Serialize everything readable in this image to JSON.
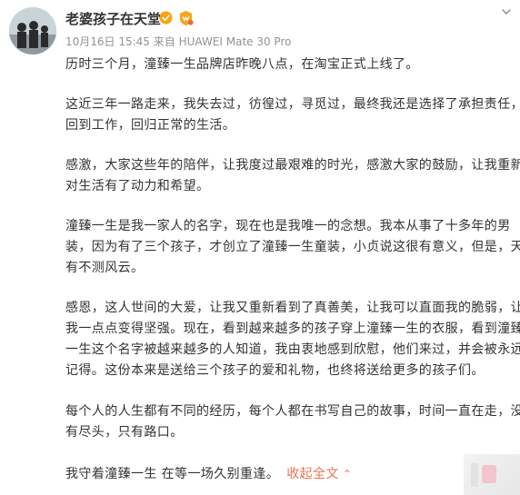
{
  "user": {
    "name": "老婆孩子在天堂"
  },
  "meta": {
    "datetime": "10月16日 15:45",
    "source": "来自 HUAWEI Mate 30 Pro"
  },
  "post": {
    "paragraphs": [
      [
        "历时三个月，潼臻一生品牌店昨晚八点，在淘宝正式上线了。"
      ],
      [
        "这近三年一路走来，我失去过，彷徨过，寻觅过，最终我还是选择了承担责任，",
        "回到工作，回归正常的生活。"
      ],
      [
        "感激，大家这些年的陪伴，让我度过最艰难的时光，感激大家的鼓励，让我重新",
        "对生活有了动力和希望。"
      ],
      [
        "潼臻一生是我一家人的名字，现在也是我唯一的念想。我本从事了十多年的男",
        "装，因为有了三个孩子，才创立了潼臻一生童装，小贞说这很有意义，但是，天",
        "有不测风云。"
      ],
      [
        "感恩，这人世间的大爱，让我又重新看到了真善美，让我可以直面我的脆弱，让",
        "我一点点变得坚强。现在，看到越来越多的孩子穿上潼臻一生的衣服，看到潼臻",
        "一生这个名字被越来越多的人知道，我由衷地感到欣慰，他们来过，并会被永远",
        "记得。这份本来是送给三个孩子的爱和礼物，也终将送给更多的孩子们。"
      ],
      [
        "每个人的人生都有不同的经历，每个人都在书写自己的故事，时间一直在走，没",
        "有尽头，只有路口。"
      ],
      [
        "我守着潼臻一生 在等一场久别重逢。"
      ]
    ],
    "collapse_label": "收起全文",
    "collapse_icon": "chevron-up-icon"
  },
  "icons": {
    "verified": "verified-badge-icon",
    "vip": "vip-badge-icon",
    "menu": "chevron-down-icon"
  },
  "colors": {
    "text": "#333333",
    "meta": "#939393",
    "link": "#eb7350",
    "verified": "#f8a20f",
    "vip": "#f4a623"
  }
}
